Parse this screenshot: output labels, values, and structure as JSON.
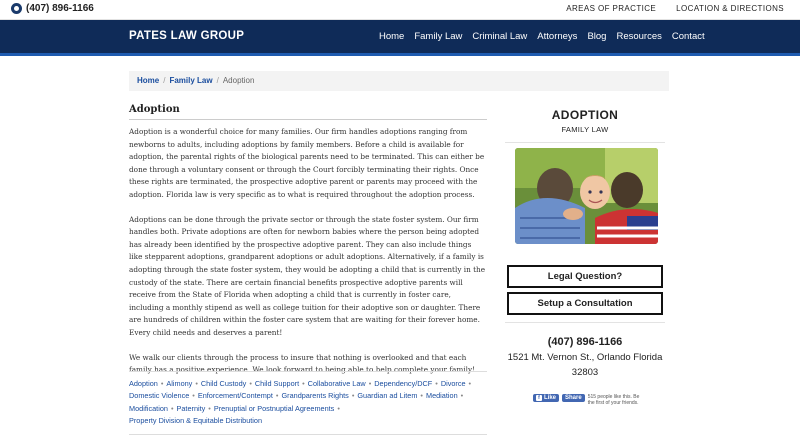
{
  "topbar": {
    "phone": "(407) 896-1166",
    "links": [
      "AREAS OF PRACTICE",
      "LOCATION & DIRECTIONS"
    ]
  },
  "header": {
    "brand": "PATES LAW GROUP",
    "nav": [
      "Home",
      "Family Law",
      "Criminal Law",
      "Attorneys",
      "Blog",
      "Resources",
      "Contact"
    ]
  },
  "breadcrumb": [
    "Home",
    "Family Law",
    "Adoption"
  ],
  "article": {
    "title": "Adoption",
    "paragraphs": [
      "Adoption is a wonderful choice for many families. Our firm handles adoptions ranging from newborns to adults, including adoptions by family members. Before a child is available for adoption, the parental rights of the biological parents need to be terminated. This can either be done through a voluntary consent or through the Court forcibly terminating their rights. Once these rights are terminated, the prospective adoptive parent or parents may proceed with the adoption. Florida law is very specific as to what is required throughout the adoption process.",
      "Adoptions can be done through the private sector or through the state foster system. Our firm handles both. Private adoptions are often for newborn babies where the person being adopted has already been identified by the prospective adoptive parent. They can also include things like stepparent adoptions, grandparent adoptions or adult adoptions. Alternatively, if a family is adopting through the state foster system, they would be adopting a child that is currently in the custody of the state. There are certain financial benefits prospective adoptive parents will receive from the State of Florida when adopting a child that is currently in foster care, including a monthly stipend as well as college tuition for their adoptive son or daughter. There are hundreds of children within the foster care system that are waiting for their forever home. Every child needs and deserves a parent!",
      "We walk our clients through the process to insure that nothing is overlooked and that each family has a positive experience. We look forward to being able to help complete your family!"
    ]
  },
  "tags": [
    "Adoption",
    "Alimony",
    "Child Custody",
    "Child Support",
    "Collaborative Law",
    "Dependency/DCF",
    "Divorce",
    "Domestic Violence",
    "Enforcement/Contempt",
    "Grandparents Rights",
    "Guardian ad Litem",
    "Mediation",
    "Modification",
    "Paternity",
    "Prenuptial or Postnuptial Agreements",
    "Property Division & Equitable Distribution"
  ],
  "sidebar": {
    "title": "ADOPTION",
    "subtitle": "FAMILY LAW",
    "cta_question": "Legal Question?",
    "cta_consult": "Setup a Consultation",
    "phone": "(407) 896-1166",
    "address_line1": "1521 Mt. Vernon St., Orlando Florida",
    "address_line2": "32803",
    "fb_like": "Like",
    "fb_share": "Share",
    "fb_text": "515 people like this. Be the first of your friends."
  },
  "colors": {
    "nav_bg": "#0f2b58",
    "nav_accent": "#1e5bb0",
    "link": "#1a4d9e"
  },
  "icons": {
    "phone": "phone-icon",
    "facebook": "facebook-icon"
  }
}
